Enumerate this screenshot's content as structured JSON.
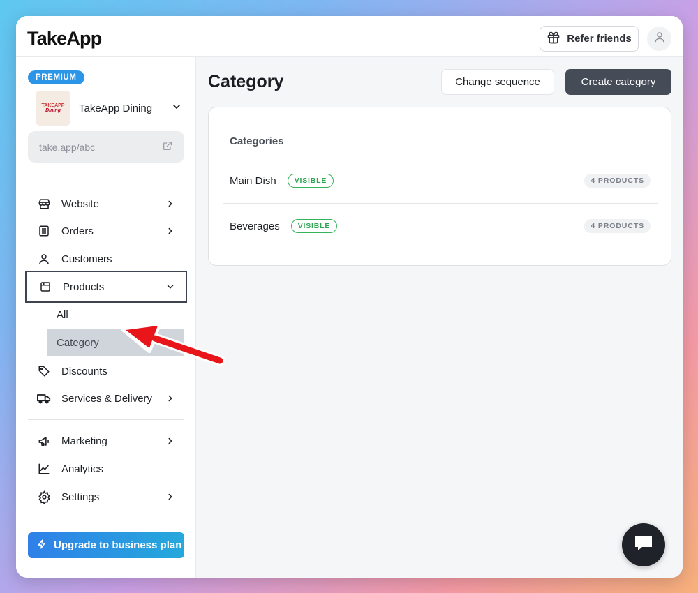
{
  "app": {
    "logo": "TakeApp"
  },
  "header": {
    "refer_label": "Refer friends",
    "refer_icon": "gift-icon",
    "account_icon": "user-icon"
  },
  "sidebar": {
    "plan_badge": "PREMIUM",
    "store_name": "TakeApp Dining",
    "store_logo_text": [
      "TAKEAPP",
      "Dining"
    ],
    "store_url": "take.app/abc",
    "items": [
      {
        "label": "Website",
        "icon": "store-icon",
        "chevron": true
      },
      {
        "label": "Orders",
        "icon": "receipt-icon",
        "chevron": true
      },
      {
        "label": "Customers",
        "icon": "user-icon",
        "chevron": false
      },
      {
        "label": "Products",
        "icon": "box-icon",
        "chevron": "down",
        "expanded": true
      },
      {
        "label": "Discounts",
        "icon": "tag-icon",
        "chevron": false
      },
      {
        "label": "Services & Delivery",
        "icon": "truck-icon",
        "chevron": true
      },
      {
        "label": "Marketing",
        "icon": "megaphone-icon",
        "chevron": true
      },
      {
        "label": "Analytics",
        "icon": "chart-icon",
        "chevron": false
      },
      {
        "label": "Settings",
        "icon": "gear-icon",
        "chevron": true
      }
    ],
    "product_subitems": [
      {
        "label": "All",
        "active": false
      },
      {
        "label": "Category",
        "active": true
      }
    ],
    "upgrade_label": "Upgrade to business plan"
  },
  "main": {
    "title": "Category",
    "change_sequence_label": "Change sequence",
    "create_category_label": "Create category",
    "card_title": "Categories",
    "categories": [
      {
        "name": "Main Dish",
        "status": "VISIBLE",
        "count": "4 PRODUCTS"
      },
      {
        "name": "Beverages",
        "status": "VISIBLE",
        "count": "4 PRODUCTS"
      }
    ]
  },
  "colors": {
    "accent": "#2b95e8",
    "visible_green": "#34b45a",
    "dark_button": "#464c57",
    "annotation_arrow": "#e8161b"
  }
}
